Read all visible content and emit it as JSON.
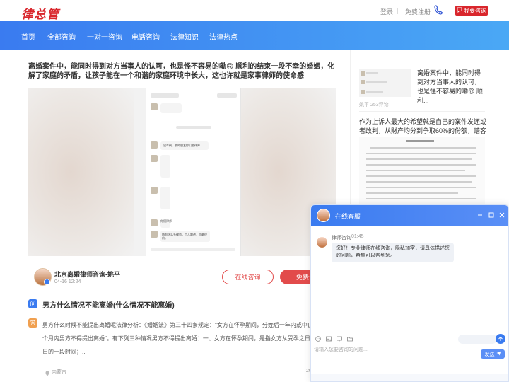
{
  "topbar": {
    "logo": "律总管",
    "login": "登录",
    "register": "免费注册",
    "consult_button": "我要咨询"
  },
  "nav": {
    "items": [
      "首页",
      "全部咨询",
      "一对一咨询",
      "电话咨询",
      "法律知识",
      "法律热点"
    ]
  },
  "article": {
    "title": "离婚案件中，能同时得到对方当事人的认可，也是怪不容易的嘞🙃 顺利的结束一段不幸的婚姻，化解了家庭的矛盾，让孩子能在一个和谐的家庭环境中长大，这也许就是家事律师的使命感",
    "screenshot_lines": [
      "出车祸，我的朋友你们要律师",
      "你们律师",
      "随船这么多律师，个人跟进，你最终前。"
    ]
  },
  "author": {
    "name": "北京离婚律师咨询-姚平",
    "time": "04-16 12:24",
    "online_button": "在线咨询",
    "free_button": "免费咨"
  },
  "qa": {
    "q_label": "问",
    "question": "男方什么情况不能离婚(什么情况不能离婚)",
    "a_label": "答",
    "answer": "男方什么时候不能提出离婚呢法律分析：《婚姻法》第三十四条规定：\"女方在怀孕期间，分娩后一年内或中止妊娠后六个月内男方不得提出离婚\"。有下列三种情况男方不得提出离婚：一、女方在怀孕期间，是指女方从受孕之日到分娩之日的一段时间；...",
    "location": "内蒙古",
    "date_fragment": "20"
  },
  "sidebar": {
    "card1_title": "离婚案件中，能同时得到对方当事人的认可，也是怪不容易的嘞🙃 顺利...",
    "card1_meta": "姚平 253评论",
    "card2_title": "作为上诉人最大的希望就是自己的案件发还或者改判，从财产均分到争取60%的份额，赔客户..."
  },
  "chat": {
    "title": "在线客服",
    "lawyer_name": "律师咨询",
    "time": "01:45",
    "message": "您好！专业律师在线咨询，隐私加密，请具体描述您的问题，希望可以帮到您。",
    "input_placeholder": "请输入您要咨询的问题...",
    "send_label": "发送"
  },
  "colors": {
    "brand_red": "#d9262c",
    "nav_blue": "#3a7bf0",
    "accent_red": "#e24b4b"
  }
}
